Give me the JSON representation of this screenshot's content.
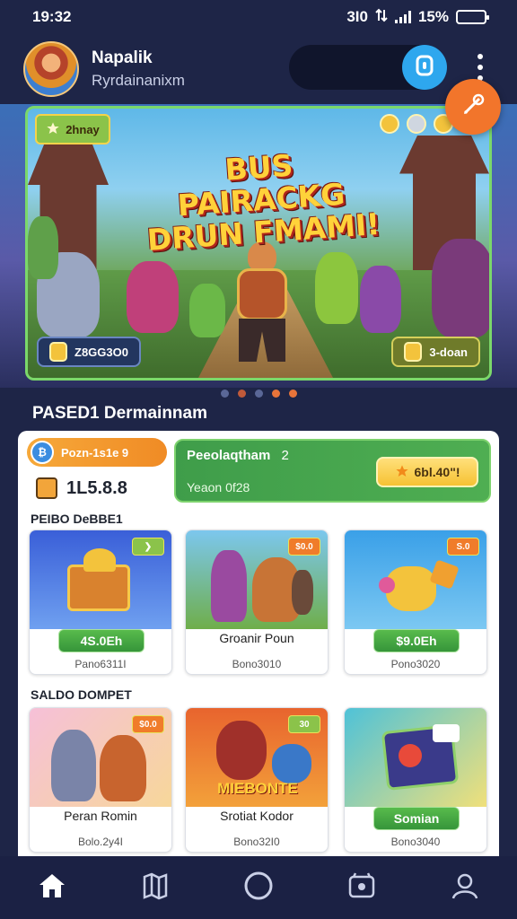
{
  "status_bar": {
    "time": "19:32",
    "network": "3I0",
    "data_icon": "data-transfer-icon",
    "battery_text": "15%",
    "battery_level": 0.15
  },
  "header": {
    "user_name": "Napalik",
    "user_subtitle": "Ryrdainanixm",
    "action_icon": "wallet-icon",
    "menu_icon": "more-vertical-icon",
    "fab_icon": "edit-icon"
  },
  "hero": {
    "badge": "2hnay",
    "title_line1": "BUS PAIRACKG",
    "title_line2": "DRUN FMAMI!",
    "left_chip": "Z8GG3O0",
    "right_chip": "3-doan"
  },
  "carousel": {
    "dot_colors": [
      "#5a6797",
      "#c05a3a",
      "#5a6797",
      "#e8743a",
      "#e8743a"
    ]
  },
  "section": {
    "title": "PASED1 Dermainnam"
  },
  "balance": {
    "label": "Pozn-1s1e 9",
    "value": "1L5.8.8"
  },
  "promo": {
    "title": "Peeolaqtham",
    "title_suffix": "2",
    "subtitle": "Yeaon 0f28",
    "button": "6bl.40\"!"
  },
  "group1": {
    "heading": "PEIBO DeBBE1"
  },
  "group2": {
    "heading": "SALDO DOMPET"
  },
  "cards_row1": [
    {
      "tag": "",
      "button": "4S.0Eh",
      "label": "",
      "meta": "Pano6311I"
    },
    {
      "tag": "$0.0",
      "button": "",
      "label": "Groanir Poun",
      "meta": "Bono3010"
    },
    {
      "tag": "S.0",
      "button": "$9.0Eh",
      "label": "",
      "meta": "Pono3020"
    }
  ],
  "cards_row2": [
    {
      "tag": "$0.0",
      "button": "",
      "label": "Peran Romin",
      "meta": "Bolo.2y4I"
    },
    {
      "tag": "30",
      "button": "",
      "label": "Srotiat Kodor",
      "meta": "Bono32I0",
      "art_text": "MIEBONTE"
    },
    {
      "tag": "",
      "button": "Somian",
      "label": "",
      "meta": "Bono3040"
    }
  ],
  "colors": {
    "accent_orange": "#f2752b",
    "accent_blue": "#2ea7ee",
    "accent_green": "#3f9d4a",
    "background": "#1e2547"
  },
  "nav": [
    {
      "icon": "home-icon",
      "active": true
    },
    {
      "icon": "map-icon",
      "active": false
    },
    {
      "icon": "circle-icon",
      "active": false
    },
    {
      "icon": "inventory-icon",
      "active": false
    },
    {
      "icon": "profile-icon",
      "active": false
    }
  ]
}
